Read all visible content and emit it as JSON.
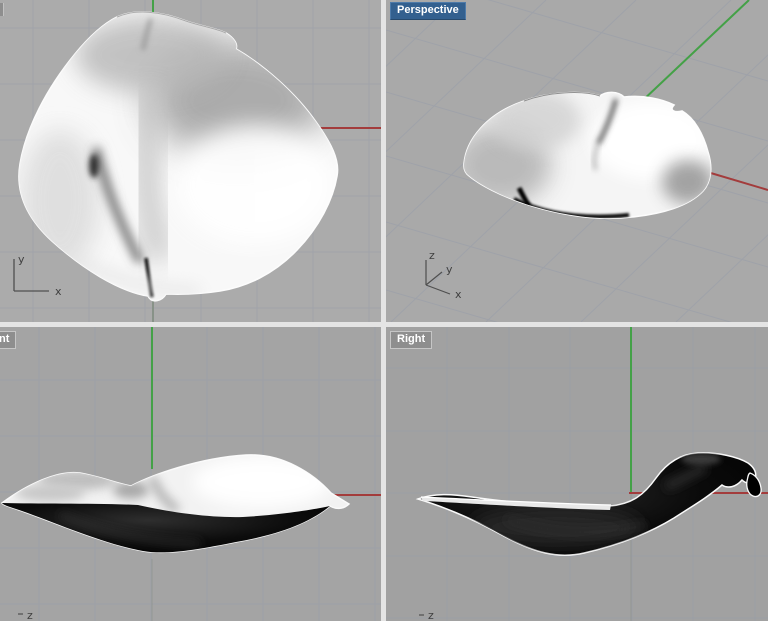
{
  "app": {
    "kind": "3d-modeler-four-viewport-layout"
  },
  "colors": {
    "viewport_background_top": "#ababab",
    "viewport_background_perspective": "#a9a9a9",
    "viewport_background_front": "#a4a4a4",
    "viewport_background_right": "#a1a1a1",
    "grid_line": "#979daa",
    "divider": "#e4e4e4",
    "x_axis_red": "#a33c3c",
    "y_axis_green": "#44a147",
    "dim_negative_axis": "#848c84",
    "perspective_badge_bg": "#33608f",
    "side_badge_bg": "#8e8e8e",
    "badge_text": "#ffffff",
    "object_surface_light": "#f8f8f8",
    "object_surface_dark": "#000000",
    "silhouette_outline": "#fcfcfc"
  },
  "viewports": [
    {
      "id": "top",
      "label": "",
      "gizmo": {
        "v": "y",
        "h": "x"
      }
    },
    {
      "id": "perspective",
      "label": "Perspective",
      "gizmo": {
        "v": "z",
        "m": "y",
        "h": "x"
      }
    },
    {
      "id": "front",
      "label": "nt",
      "gizmo": {
        "v": "z"
      }
    },
    {
      "id": "right",
      "label": "Right",
      "gizmo": {
        "v": "z"
      }
    }
  ]
}
